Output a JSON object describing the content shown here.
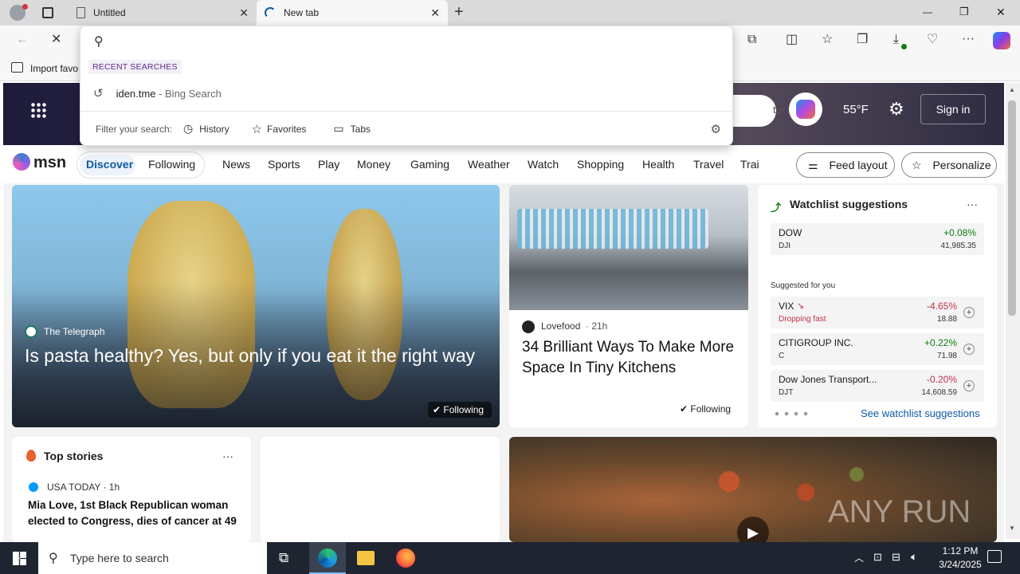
{
  "tabs": [
    {
      "title": "Untitled",
      "close": "✕"
    },
    {
      "title": "New tab",
      "close": "✕"
    }
  ],
  "new_tab_glyph": "+",
  "window_controls": {
    "minimize": "—",
    "restore": "❐",
    "close": "✕"
  },
  "favorites_bar": {
    "import_label": "Import favo"
  },
  "omnibox": {
    "placeholder": "",
    "recent_title": "RECENT SEARCHES",
    "recent_items": [
      {
        "query": "iden.tme",
        "suffix": " - Bing Search"
      }
    ],
    "filter_label": "Filter your search:",
    "filters": [
      "History",
      "Favorites",
      "Tabs"
    ]
  },
  "msn_header": {
    "search_text": "ter in",
    "temperature": "55°F",
    "sign_in": "Sign in"
  },
  "msn_nav": {
    "logo": "msn",
    "pills": [
      "Discover",
      "Following"
    ],
    "items": [
      "News",
      "Sports",
      "Play",
      "Money",
      "Gaming",
      "Weather",
      "Watch",
      "Shopping",
      "Health",
      "Travel",
      "Trai"
    ],
    "feed_layout": "Feed layout",
    "personalize": "Personalize"
  },
  "hero": {
    "source": "The Telegraph",
    "title": "Is pasta healthy? Yes, but only if you eat it the right way",
    "following": "Following"
  },
  "card2": {
    "source": "Lovefood",
    "age": "· 21h",
    "title": "34 Brilliant Ways To Make More Space In Tiny Kitchens",
    "following": "Following"
  },
  "watchlist": {
    "title": "Watchlist suggestions",
    "more": "···",
    "top": {
      "name": "DOW",
      "sym": "DJI",
      "change": "+0.08%",
      "price": "41,985.35"
    },
    "suggested_label": "Suggested for you",
    "rows": [
      {
        "name": "VIX",
        "sub": "Dropping fast",
        "change": "-4.65%",
        "price": "18.88",
        "color": "#c4314b"
      },
      {
        "name": "CITIGROUP INC.",
        "sub": "C",
        "change": "+0.22%",
        "price": "71.98",
        "color": "#107c10"
      },
      {
        "name": "Dow Jones Transport...",
        "sub": "DJT",
        "change": "-0.20%",
        "price": "14,608.59",
        "color": "#c4314b"
      }
    ],
    "see_more": "See watchlist suggestions"
  },
  "top_stories": {
    "title": "Top stories",
    "more": "···",
    "source": "USA TODAY · 1h",
    "headline": "Mia Love, 1st Black Republican woman elected to Congress, dies of cancer at 49"
  },
  "watermark": "ANY RUN",
  "taskbar": {
    "search_placeholder": "Type here to search",
    "time": "1:12 PM",
    "date": "3/24/2025"
  }
}
